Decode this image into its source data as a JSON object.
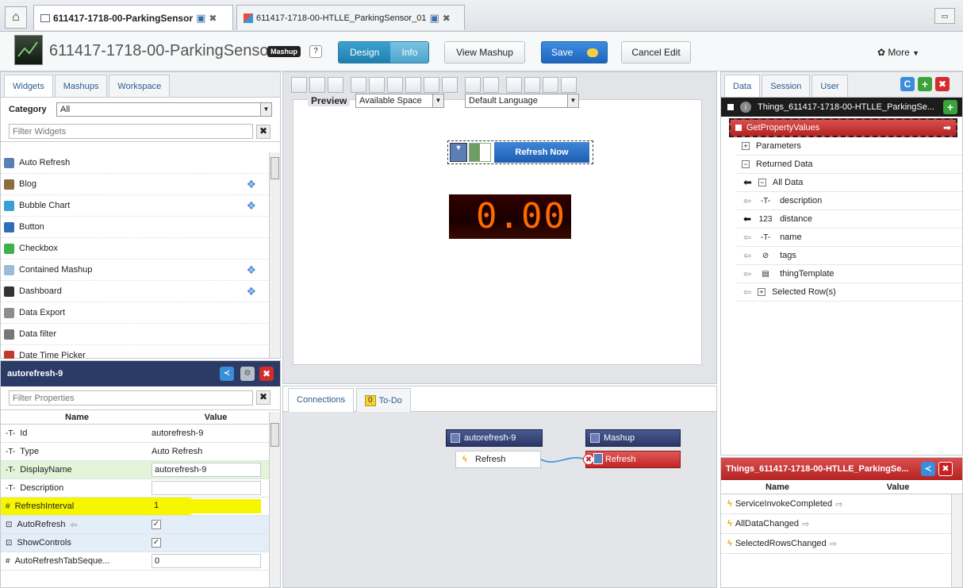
{
  "tabs": [
    {
      "label": "611417-1718-00-ParkingSensor",
      "active": true
    },
    {
      "label": "611417-1718-00-HTLLE_ParkingSensor_01",
      "active": false
    }
  ],
  "header": {
    "title": "611417-1718-00-ParkingSensor",
    "badge": "Mashup",
    "help": "?",
    "design_label": "Design",
    "info_label": "Info",
    "view_mashup_label": "View Mashup",
    "save_label": "Save",
    "cancel_label": "Cancel Edit",
    "more_label": "More"
  },
  "left_panel": {
    "tabs": [
      "Widgets",
      "Mashups",
      "Workspace"
    ],
    "category_label": "Category",
    "category_value": "All",
    "filter_placeholder": "Filter Widgets",
    "widgets": [
      {
        "label": "Auto Refresh",
        "icon": "refresh-icon",
        "color": "#5a7fb5"
      },
      {
        "label": "Blog",
        "icon": "blog-icon",
        "color": "#8a6d3b"
      },
      {
        "label": "Bubble Chart",
        "icon": "bubble-chart-icon",
        "color": "#3aa0d6"
      },
      {
        "label": "Button",
        "icon": "button-icon",
        "color": "#2c6fb7"
      },
      {
        "label": "Checkbox",
        "icon": "checkbox-icon",
        "color": "#3ab34a"
      },
      {
        "label": "Contained Mashup",
        "icon": "contained-mashup-icon",
        "color": "#9bbbd8"
      },
      {
        "label": "Dashboard",
        "icon": "dashboard-icon",
        "color": "#333333"
      },
      {
        "label": "Data Export",
        "icon": "data-export-icon",
        "color": "#8d8d8d"
      },
      {
        "label": "Data filter",
        "icon": "data-filter-icon",
        "color": "#777777"
      },
      {
        "label": "Date Time Picker",
        "icon": "date-picker-icon",
        "color": "#c0392b"
      }
    ]
  },
  "properties": {
    "title": "autorefresh-9",
    "filter_placeholder": "Filter Properties",
    "name_header": "Name",
    "value_header": "Value",
    "rows": [
      {
        "name": "Id",
        "value": "autorefresh-9",
        "kind": "text"
      },
      {
        "name": "Type",
        "value": "Auto Refresh",
        "kind": "text"
      },
      {
        "name": "DisplayName",
        "value": "autorefresh-9",
        "kind": "input"
      },
      {
        "name": "Description",
        "value": "",
        "kind": "input"
      },
      {
        "name": "RefreshInterval",
        "value": "1",
        "kind": "input"
      },
      {
        "name": "AutoRefresh",
        "value": "✓",
        "kind": "check"
      },
      {
        "name": "ShowControls",
        "value": "✓",
        "kind": "check"
      },
      {
        "name": "AutoRefreshTabSeque...",
        "value": "0",
        "kind": "input"
      }
    ]
  },
  "canvas": {
    "preview_label": "Preview",
    "space_value": "Available Space",
    "language_value": "Default Language",
    "refresh_button": "Refresh Now",
    "led_value": "0.00"
  },
  "connections": {
    "tabs": [
      "Connections",
      "To-Do"
    ],
    "todo_count": "0",
    "source_name": "autorefresh-9",
    "source_event": "Refresh",
    "target_name": "Mashup",
    "target_event": "Refresh"
  },
  "data_panel": {
    "tabs": [
      "Data",
      "Session",
      "User"
    ],
    "thing": "Things_611417-1718-00-HTLLE_ParkingSe...",
    "service": "GetPropertyValues",
    "parameters": "Parameters",
    "returned": "Returned Data",
    "all_data": "All Data",
    "fields": [
      {
        "label": "description",
        "type": "-T-"
      },
      {
        "label": "distance",
        "type": "123"
      },
      {
        "label": "name",
        "type": "-T-"
      },
      {
        "label": "tags",
        "type": "tag"
      },
      {
        "label": "thingTemplate",
        "type": "tpl"
      }
    ],
    "selected_rows": "Selected Row(s)"
  },
  "events_panel": {
    "title": "Things_611417-1718-00-HTLLE_ParkingSe...",
    "name_header": "Name",
    "value_header": "Value",
    "rows": [
      "ServiceInvokeCompleted",
      "AllDataChanged",
      "SelectedRowsChanged"
    ]
  }
}
